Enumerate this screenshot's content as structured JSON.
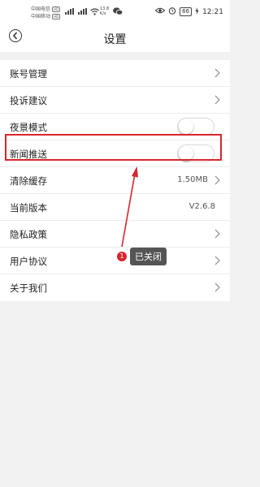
{
  "status_bar": {
    "carrier1": "中国电信",
    "carrier2": "中国移动",
    "hd1": "HD",
    "hd2": "HD",
    "speed_value": "13.8",
    "speed_unit": "K/s",
    "battery": "66",
    "time": "12:21"
  },
  "header": {
    "title": "设置"
  },
  "settings": {
    "account": "账号管理",
    "feedback": "投诉建议",
    "night_mode": "夜景模式",
    "news_push": "新闻推送",
    "clear_cache": "清除缓存",
    "cache_size": "1.50MB",
    "version_label": "当前版本",
    "version_value": "V2.6.8",
    "privacy": "隐私政策",
    "user_agreement": "用户协议",
    "about": "关于我们"
  },
  "toggles": {
    "night_mode_on": false,
    "news_push_on": false
  },
  "annotation": {
    "step_number": "1",
    "tooltip": "已关闭",
    "highlight_color": "#d9252f"
  }
}
